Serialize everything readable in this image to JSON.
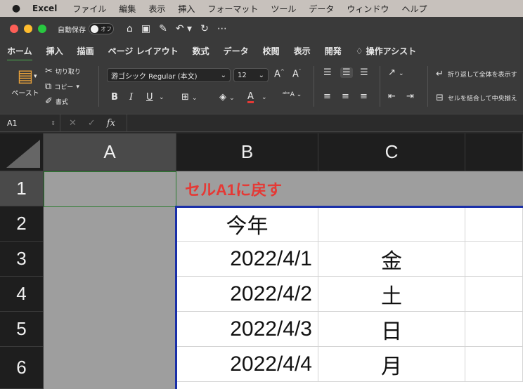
{
  "menubar": {
    "app_name": "Excel",
    "items": [
      "ファイル",
      "編集",
      "表示",
      "挿入",
      "フォーマット",
      "ツール",
      "データ",
      "ウィンドウ",
      "ヘルプ"
    ]
  },
  "titlebar": {
    "autosave_label": "自動保存",
    "toggle_label": "オフ"
  },
  "ribbon_tabs": [
    "ホーム",
    "挿入",
    "描画",
    "ページ レイアウト",
    "数式",
    "データ",
    "校閲",
    "表示",
    "開発",
    "操作アシスト"
  ],
  "ribbon": {
    "paste_label": "ペースト",
    "cut_label": "切り取り",
    "copy_label": "コピー",
    "format_painter_label": "書式",
    "font_name": "游ゴシック Regular (本文)",
    "font_size": "12",
    "bold": "B",
    "italic": "I",
    "underline": "U",
    "wrap_text_label": "折り返して全体を表示す",
    "merge_center_label": "セルを結合して中央揃え"
  },
  "formula_bar": {
    "cell_reference": "A1",
    "fx_label": "fx",
    "value": ""
  },
  "sheet": {
    "columns": [
      "A",
      "B",
      "C"
    ],
    "rows": [
      "1",
      "2",
      "3",
      "4",
      "5",
      "6"
    ],
    "cells": {
      "B1": "セルA1に戻す",
      "B2": "今年",
      "B3": "2022/4/1",
      "C3": "金",
      "B4": "2022/4/2",
      "C4": "土",
      "B5": "2022/4/3",
      "C5": "日",
      "B6": "2022/4/4",
      "C6": "月"
    }
  },
  "colors": {
    "accent_green": "#4caf50",
    "title_red": "#e53935",
    "border_blue": "#1a2fa8",
    "gray_fill": "#9e9e9e"
  }
}
